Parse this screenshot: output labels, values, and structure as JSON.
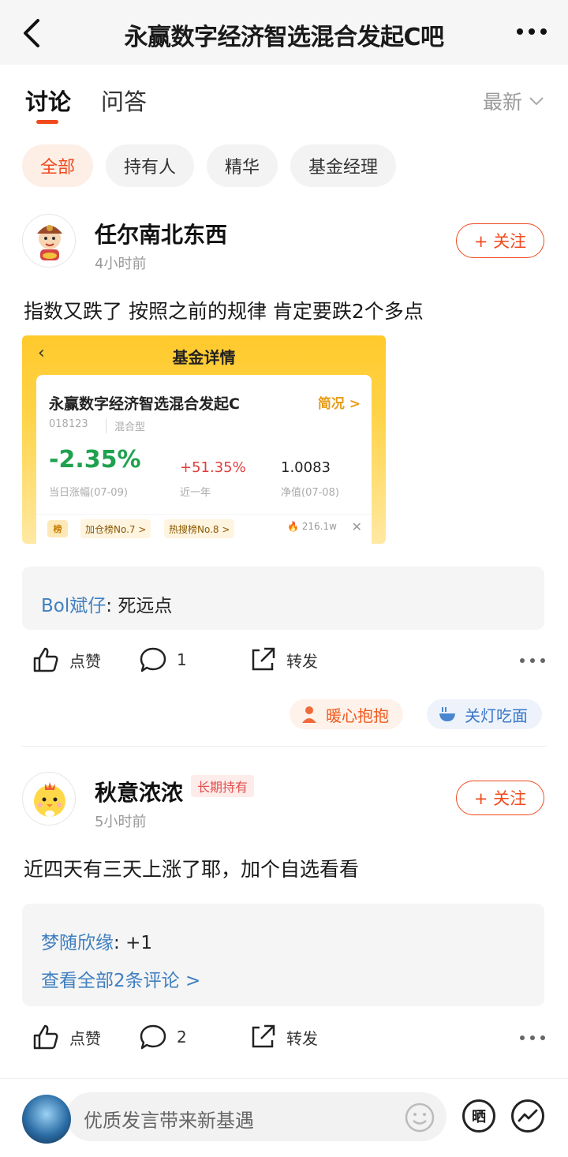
{
  "header": {
    "title": "永赢数字经济智选混合发起C吧"
  },
  "tabs": [
    {
      "label": "讨论"
    },
    {
      "label": "问答"
    }
  ],
  "sort": {
    "label": "最新"
  },
  "filters": [
    "全部",
    "持有人",
    "精华",
    "基金经理"
  ],
  "posts": [
    {
      "username": "任尔南北东西",
      "time": "4小时前",
      "follow_label": "+ 关注",
      "text": "指数又跌了 按照之前的规律 肯定要跌2个多点",
      "fund_card": {
        "header": "基金详情",
        "name": "永赢数字经济智选混合发起C",
        "brief": "简况 >",
        "code": "018123",
        "type": "混合型",
        "today_change": "-2.35%",
        "today_label": "当日涨幅(07-09)",
        "year_change": "+51.35%",
        "year_label": "近一年",
        "nav": "1.0083",
        "nav_label": "净值(07-08)",
        "rank_icon": "榜",
        "tag1": "加仓榜No.7 >",
        "tag2": "热搜榜No.8 >",
        "heat": "216.1w",
        "close": "✕"
      },
      "comments": [
        {
          "user": "Bol斌仔",
          "sep": ": ",
          "text": "死远点"
        }
      ],
      "actions": {
        "like": "点赞",
        "comment_count": "1",
        "share": "转发"
      },
      "reactions": [
        "暖心抱抱",
        "关灯吃面"
      ]
    },
    {
      "username": "秋意浓浓",
      "badge": "长期持有",
      "time": "5小时前",
      "follow_label": "+ 关注",
      "text": "近四天有三天上涨了耶，加个自选看看",
      "comments": [
        {
          "user": "梦随欣缘",
          "sep": ": ",
          "text": "+1"
        }
      ],
      "view_all": "查看全部2条评论 >",
      "actions": {
        "like": "点赞",
        "comment_count": "2",
        "share": "转发"
      }
    }
  ],
  "bottom": {
    "placeholder": "优质发言带来新基遇",
    "share_label": "晒"
  },
  "colors": {
    "accent": "#f04a1e",
    "link": "#3f7fc0",
    "up": "#e23c3c",
    "down": "#1fa14f"
  }
}
